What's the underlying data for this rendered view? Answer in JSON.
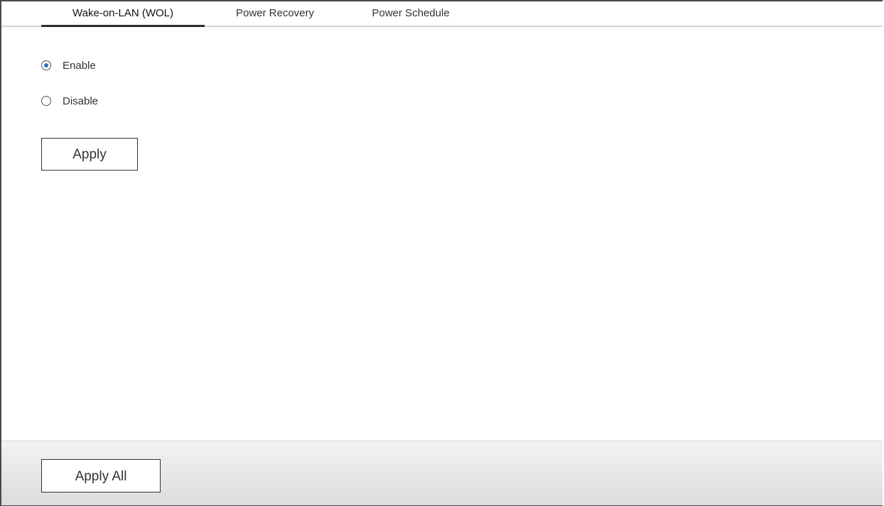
{
  "tabs": {
    "wol": "Wake-on-LAN (WOL)",
    "recovery": "Power Recovery",
    "schedule": "Power Schedule",
    "active": "wol"
  },
  "options": {
    "enable_label": "Enable",
    "disable_label": "Disable",
    "selected": "enable"
  },
  "buttons": {
    "apply": "Apply",
    "apply_all": "Apply All"
  },
  "colors": {
    "accent": "#2f6fcc",
    "footer_bg": "#e6e6e6"
  }
}
